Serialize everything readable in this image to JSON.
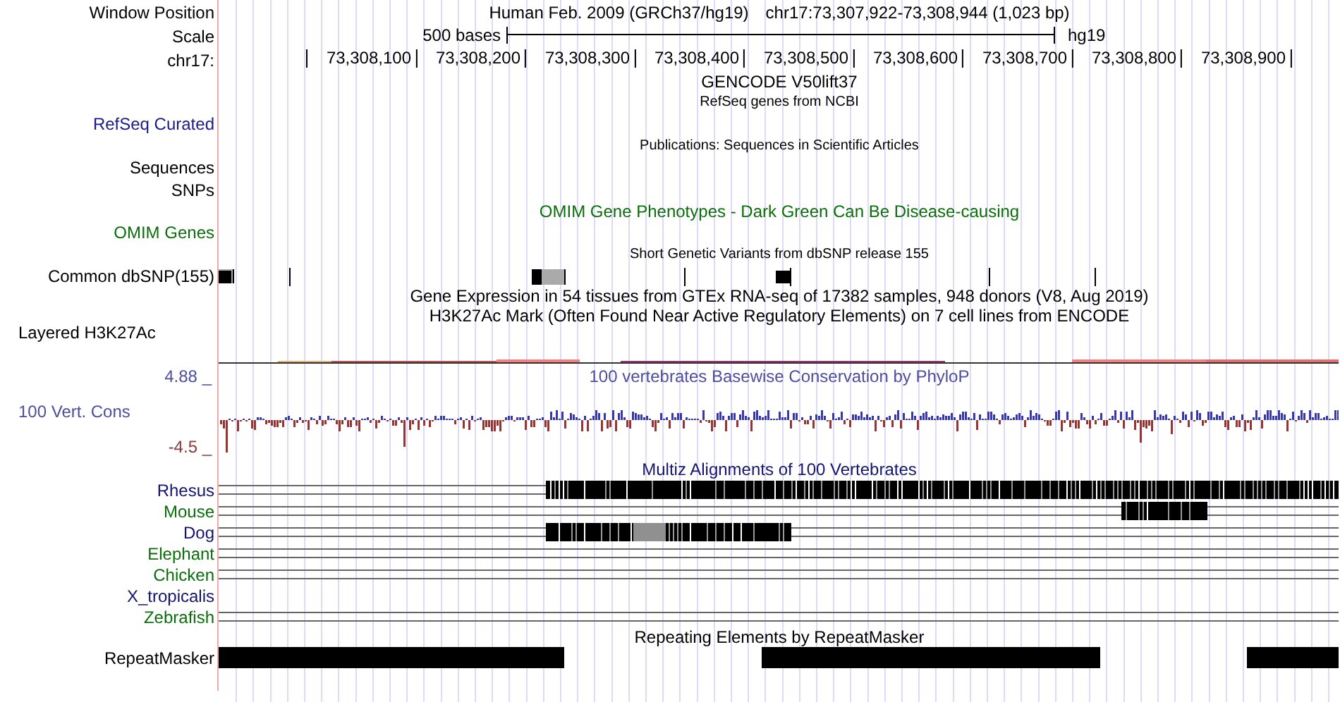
{
  "header": {
    "label": "Window Position",
    "assembly": "Human Feb. 2009 (GRCh37/hg19)",
    "position": "chr17:73,307,922-73,308,944 (1,023 bp)"
  },
  "scale": {
    "label": "Scale",
    "text": "500 bases",
    "db": "hg19"
  },
  "ruler": {
    "label": "chr17:",
    "ticks": [
      "73,308,100",
      "73,308,200",
      "73,308,300",
      "73,308,400",
      "73,308,500",
      "73,308,600",
      "73,308,700",
      "73,308,800",
      "73,308,900"
    ]
  },
  "rows": [
    {
      "kind": "title",
      "title": {
        "text": "GENCODE V50lift37",
        "color": "#000000"
      }
    },
    {
      "kind": "small",
      "title": {
        "text": "RefSeq genes from NCBI",
        "color": "#000000"
      }
    },
    {
      "kind": "label",
      "label": "RefSeq Curated",
      "color": "#1a1a8c"
    },
    {
      "kind": "small",
      "title": {
        "text": "Publications: Sequences in Scientific Articles",
        "color": "#000000"
      }
    },
    {
      "kind": "label",
      "label": "Sequences",
      "color": "#000000"
    },
    {
      "kind": "label",
      "label": "SNPs",
      "color": "#000000"
    },
    {
      "kind": "title",
      "title": {
        "text": "OMIM Gene Phenotypes - Dark Green Can Be Disease-causing",
        "color": "#0a6e0a"
      }
    },
    {
      "kind": "label",
      "label": "OMIM Genes",
      "color": "#0a6e0a"
    },
    {
      "kind": "small",
      "title": {
        "text": "Short Genetic Variants from dbSNP release 155",
        "color": "#000000"
      }
    },
    {
      "kind": "snp",
      "label": "Common dbSNP(155)",
      "color": "#000000"
    },
    {
      "kind": "title",
      "title": {
        "text": "Gene Expression in 54 tissues from GTEx RNA-seq of 17382 samples, 948 donors (V8, Aug 2019)",
        "color": "#000000"
      }
    },
    {
      "kind": "title",
      "title": {
        "text": "H3K27Ac Mark (Often Found Near Active Regulatory Elements) on 7 cell lines from ENCODE",
        "color": "#000000"
      }
    },
    {
      "kind": "layered",
      "label": "Layered H3K27Ac",
      "color": "#000000"
    },
    {
      "kind": "wiggle",
      "label": "100 Vert. Cons",
      "color": "#4e4e9e",
      "max_label": "4.88 _",
      "min_label": "-4.5 _",
      "title": {
        "text": "100 vertebrates Basewise Conservation by PhyloP",
        "color": "#4e4e9e"
      }
    },
    {
      "kind": "title",
      "title": {
        "text": "Multiz Alignments of 100 Vertebrates",
        "color": "#141470"
      }
    },
    {
      "kind": "species",
      "label": "Rhesus",
      "color": "#141470",
      "aligned": true
    },
    {
      "kind": "species",
      "label": "Mouse",
      "color": "#0a6e0a",
      "aligned": true
    },
    {
      "kind": "species",
      "label": "Dog",
      "color": "#141470",
      "aligned": true
    },
    {
      "kind": "species",
      "label": "Elephant",
      "color": "#0a6e0a",
      "aligned": true
    },
    {
      "kind": "species",
      "label": "Chicken",
      "color": "#0a6e0a",
      "aligned": true
    },
    {
      "kind": "species",
      "label": "X_tropicalis",
      "color": "#141470",
      "aligned": false
    },
    {
      "kind": "species",
      "label": "Zebrafish",
      "color": "#0a6e0a",
      "aligned": true
    },
    {
      "kind": "title",
      "title": {
        "text": "Repeating Elements by RepeatMasker",
        "color": "#000000"
      }
    },
    {
      "kind": "repeat",
      "label": "RepeatMasker",
      "color": "#000000"
    }
  ]
}
